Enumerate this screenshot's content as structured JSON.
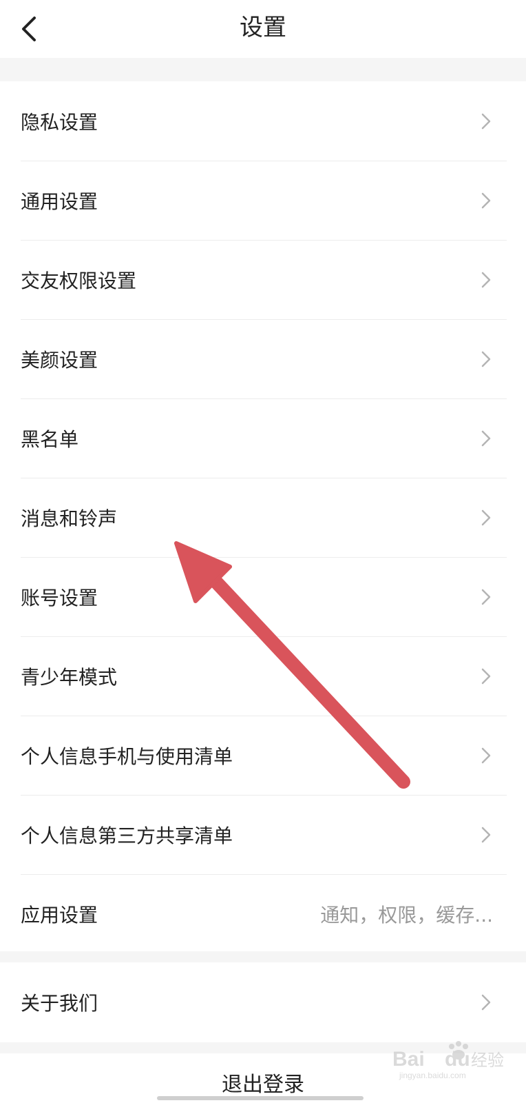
{
  "header": {
    "title": "设置",
    "back_icon": "chevron-left-icon"
  },
  "settings": {
    "items": [
      {
        "label": "隐私设置",
        "icon": "chevron-right-icon"
      },
      {
        "label": "通用设置",
        "icon": "chevron-right-icon"
      },
      {
        "label": "交友权限设置",
        "icon": "chevron-right-icon"
      },
      {
        "label": "美颜设置",
        "icon": "chevron-right-icon"
      },
      {
        "label": "黑名单",
        "icon": "chevron-right-icon"
      },
      {
        "label": "消息和铃声",
        "icon": "chevron-right-icon"
      },
      {
        "label": "账号设置",
        "icon": "chevron-right-icon"
      },
      {
        "label": "青少年模式",
        "icon": "chevron-right-icon"
      },
      {
        "label": "个人信息手机与使用清单",
        "icon": "chevron-right-icon"
      },
      {
        "label": "个人信息第三方共享清单",
        "icon": "chevron-right-icon"
      },
      {
        "label": "应用设置",
        "hint": "通知，权限，缓存..."
      }
    ]
  },
  "about": {
    "label": "关于我们",
    "icon": "chevron-right-icon"
  },
  "logout": {
    "label": "退出登录"
  },
  "colors": {
    "background": "#f5f5f5",
    "card": "#ffffff",
    "text": "#222222",
    "hint": "#999999",
    "chevron": "#b4b4b4",
    "arrow": "#d9545b"
  },
  "watermark": {
    "text": "Baidu经验",
    "subtext": "jingyan.baidu.com"
  }
}
